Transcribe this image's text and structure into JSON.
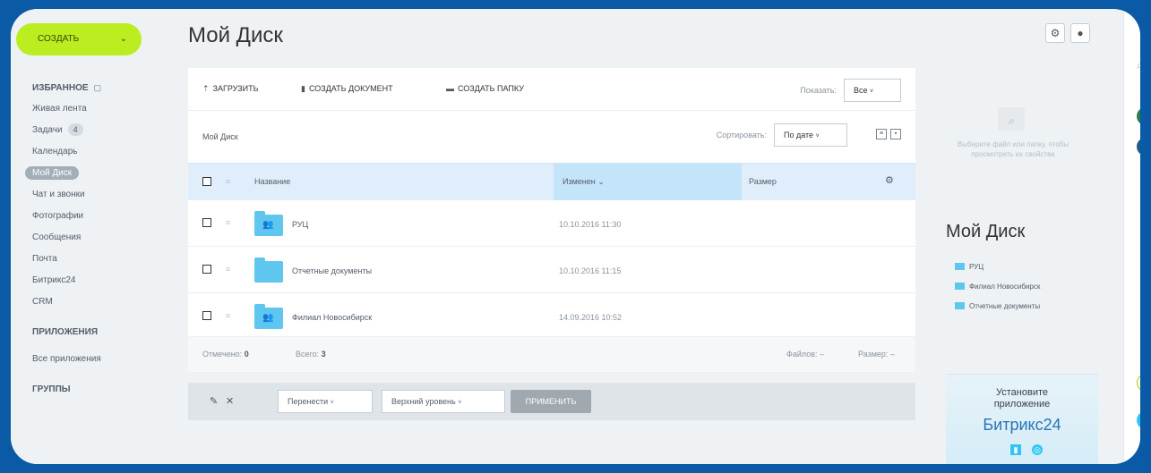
{
  "sidebar": {
    "create_label": "создать",
    "items": [
      {
        "label": "ИЗБРАННОЕ",
        "type": "section"
      },
      {
        "label": "Живая лента"
      },
      {
        "label": "Задачи",
        "count": "4"
      },
      {
        "label": "Календарь"
      },
      {
        "label": "Мой Диск",
        "active": true
      },
      {
        "label": "Чат и звонки"
      },
      {
        "label": "Фотографии"
      },
      {
        "label": "Сообщения"
      },
      {
        "label": "Почта"
      },
      {
        "label": "Битрикс24"
      },
      {
        "label": "CRM"
      },
      {
        "label": "ПРИЛОЖЕНИЯ",
        "type": "section"
      },
      {
        "label": "Все приложения"
      },
      {
        "label": "ГРУППЫ",
        "type": "section"
      }
    ]
  },
  "header": {
    "title": "Мой Диск"
  },
  "toolbar": {
    "upload_label": "ЗАГРУЗИТЬ",
    "create_doc_label": "СОЗДАТЬ ДОКУМЕНТ",
    "create_folder_label": "СОЗДАТЬ ПАПКУ",
    "show_label": "Показать:",
    "show_value": "Все"
  },
  "breadcrumb": {
    "path": "Мой Диск",
    "sort_label": "Сортировать:",
    "sort_value": "По дате"
  },
  "table": {
    "col_name": "Название",
    "col_modified": "Изменен",
    "col_size": "Размер",
    "rows": [
      {
        "name": "РУЦ",
        "modified": "10.10.2016 11:30",
        "shared": true
      },
      {
        "name": "Отчетные документы",
        "modified": "10.10.2016 11:15",
        "shared": false
      },
      {
        "name": "Филиал Новосибирск",
        "modified": "14.09.2016 10:52",
        "shared": true
      }
    ],
    "footer": {
      "selected_label": "Отмечено:",
      "selected_value": "0",
      "total_label": "Всего:",
      "total_value": "3",
      "files_label": "Файлов:",
      "size_label": "Размер:"
    }
  },
  "actions": {
    "move_label": "Перенести",
    "level_label": "Верхний уровень",
    "apply_label": "применить"
  },
  "right_panel": {
    "preview_hint": "Выберите файл или папку, чтобы просмотреть их свойства",
    "title": "Мой Диск",
    "items": [
      "РУЦ",
      "Филиал Новосибирск",
      "Отчетные документы"
    ],
    "promo_line1": "Установите",
    "promo_line2": "приложение",
    "promo_brand": "Битрикс24"
  },
  "colors": {
    "accent_green": "#bbed21",
    "folder_blue": "#5fc6f0",
    "frame_blue": "#0b5aa6"
  }
}
